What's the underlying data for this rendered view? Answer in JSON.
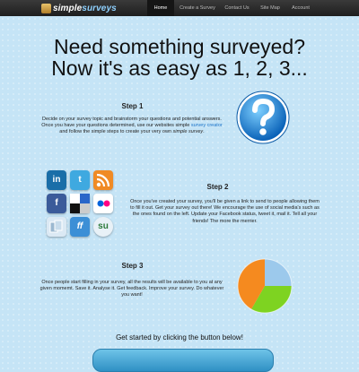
{
  "header": {
    "logo_part1": "simple",
    "logo_part2": "surveys",
    "nav": [
      "Home",
      "Create a Survey",
      "Contact Us",
      "Site Map",
      "Account"
    ]
  },
  "headline": {
    "line1": "Need something surveyed?",
    "line2": "Now it's as easy as 1, 2, 3..."
  },
  "step1": {
    "title": "Step 1",
    "text_before": "Decide on your survey topic and brainstorm your questions and potential answers. Once you have your questions determined, use our websites simple ",
    "link": "survey creator",
    "text_mid": " and follow the simple steps to create your very own ",
    "italic": "simple survey",
    "text_end": "."
  },
  "step2": {
    "title": "Step 2",
    "text": "Once you've created your survey, you'll be given a link to send to people allowing them to fill it out. Get your survey out there! We encourage the use of social media's such as the ones found on the left. Update your Facebook status, tweet it, mail it. Tell all your friends! The more the merrier."
  },
  "step3": {
    "title": "Step 3",
    "text": "Once people start filling in your survey, all the results will be available to you at any given momemt. Save it. Analyse it. Get feedback. Improve your survey. Do whatever you want!"
  },
  "social_icons": [
    {
      "name": "linkedin-icon",
      "glyph": "in",
      "color": "#1a6ea8"
    },
    {
      "name": "twitter-icon",
      "glyph": "t",
      "color": "#3fa9e0"
    },
    {
      "name": "rss-icon",
      "glyph": "",
      "color": "#f08a24"
    },
    {
      "name": "facebook-icon",
      "glyph": "f",
      "color": "#3b5b9a"
    },
    {
      "name": "delicious-icon",
      "glyph": "",
      "color": "#222222"
    },
    {
      "name": "flickr-icon",
      "glyph": "",
      "color": "#ffffff"
    },
    {
      "name": "digg-icon",
      "glyph": "",
      "color": "#8fc8ee"
    },
    {
      "name": "friendfeed-icon",
      "glyph": "ff",
      "color": "#3c8fd6"
    },
    {
      "name": "stumbleupon-icon",
      "glyph": "su",
      "color": "#e8f1f7"
    }
  ],
  "pie_colors": [
    "#f58a1f",
    "#7ed321",
    "#9cc9ec"
  ],
  "cta": {
    "text": "Get started by clicking the button below!"
  },
  "colors": {
    "background": "#c5e4f6",
    "topbar": "#1e1e1e",
    "link": "#1a73c9",
    "button": "#3a9ad0"
  }
}
